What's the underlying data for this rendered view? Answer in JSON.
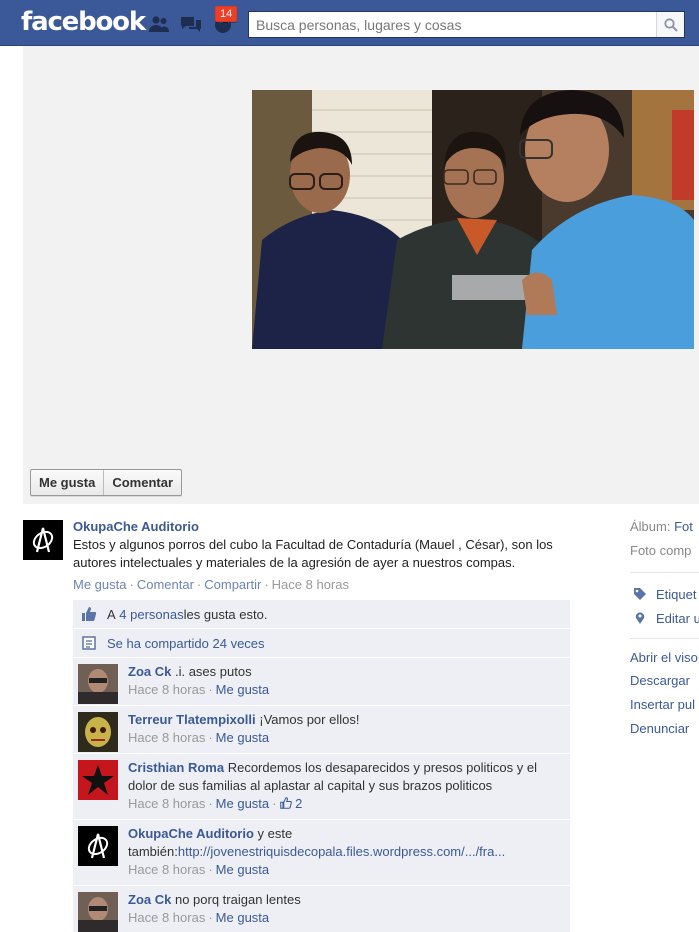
{
  "topbar": {
    "logo": "facebook",
    "notifications_count": "14",
    "search_placeholder": "Busca personas, lugares y cosas",
    "icons": [
      "friend-requests-icon",
      "messages-icon",
      "notifications-icon",
      "search-icon"
    ]
  },
  "photo_actions": {
    "like_label": "Me gusta",
    "comment_label": "Comentar"
  },
  "post": {
    "author": "OkupaChe Auditorio",
    "text": "Estos y algunos porros del cubo la Facultad de Contaduría (Mauel , César), son los autores intelectuales y materiales de la agresión de ayer a nuestros compas.",
    "meta": {
      "like": "Me gusta",
      "comment": "Comentar",
      "share": "Compartir",
      "time": "Hace 8 horas"
    }
  },
  "feedback": {
    "likes_prefix": "A ",
    "likes_link": "4 personas",
    "likes_suffix": " les gusta esto.",
    "shares": "Se ha compartido 24 veces"
  },
  "comments": [
    {
      "author": "Zoa Ck",
      "text": ".i. ases putos",
      "time": "Hace 8 horas",
      "like": "Me gusta"
    },
    {
      "author": "Terreur Tlatempixolli",
      "text": "¡Vamos por ellos!",
      "time": "Hace 8 horas",
      "like": "Me gusta"
    },
    {
      "author": "Cristhian Roma",
      "text": "Recordemos los desaparecidos y presos politicos y el dolor de sus familias al aplastar al capital y sus brazos politicos",
      "time": "Hace 8 horas",
      "like": "Me gusta",
      "likes": "2"
    },
    {
      "author": "OkupaChe Auditorio",
      "text": "y este también:",
      "link": "http://jovenestriquisdecopala.files.wordpress.com/.../fra...",
      "time": "Hace 8 horas",
      "like": "Me gusta"
    },
    {
      "author": "Zoa Ck",
      "text": "no porq traigan lentes",
      "time": "Hace 8 horas",
      "like": "Me gusta"
    }
  ],
  "sidebar": {
    "album_label": "Álbum:",
    "album_value": "Fot",
    "photo_of": "Foto comp",
    "tag": "Etiquet",
    "edit": "Editar u",
    "links": [
      "Abrir el viso",
      "Descargar",
      "Insertar pul",
      "Denunciar"
    ]
  },
  "colors": {
    "brand": "#3b5998",
    "badge": "#f03d25",
    "ufi_bg": "#edeff4"
  }
}
